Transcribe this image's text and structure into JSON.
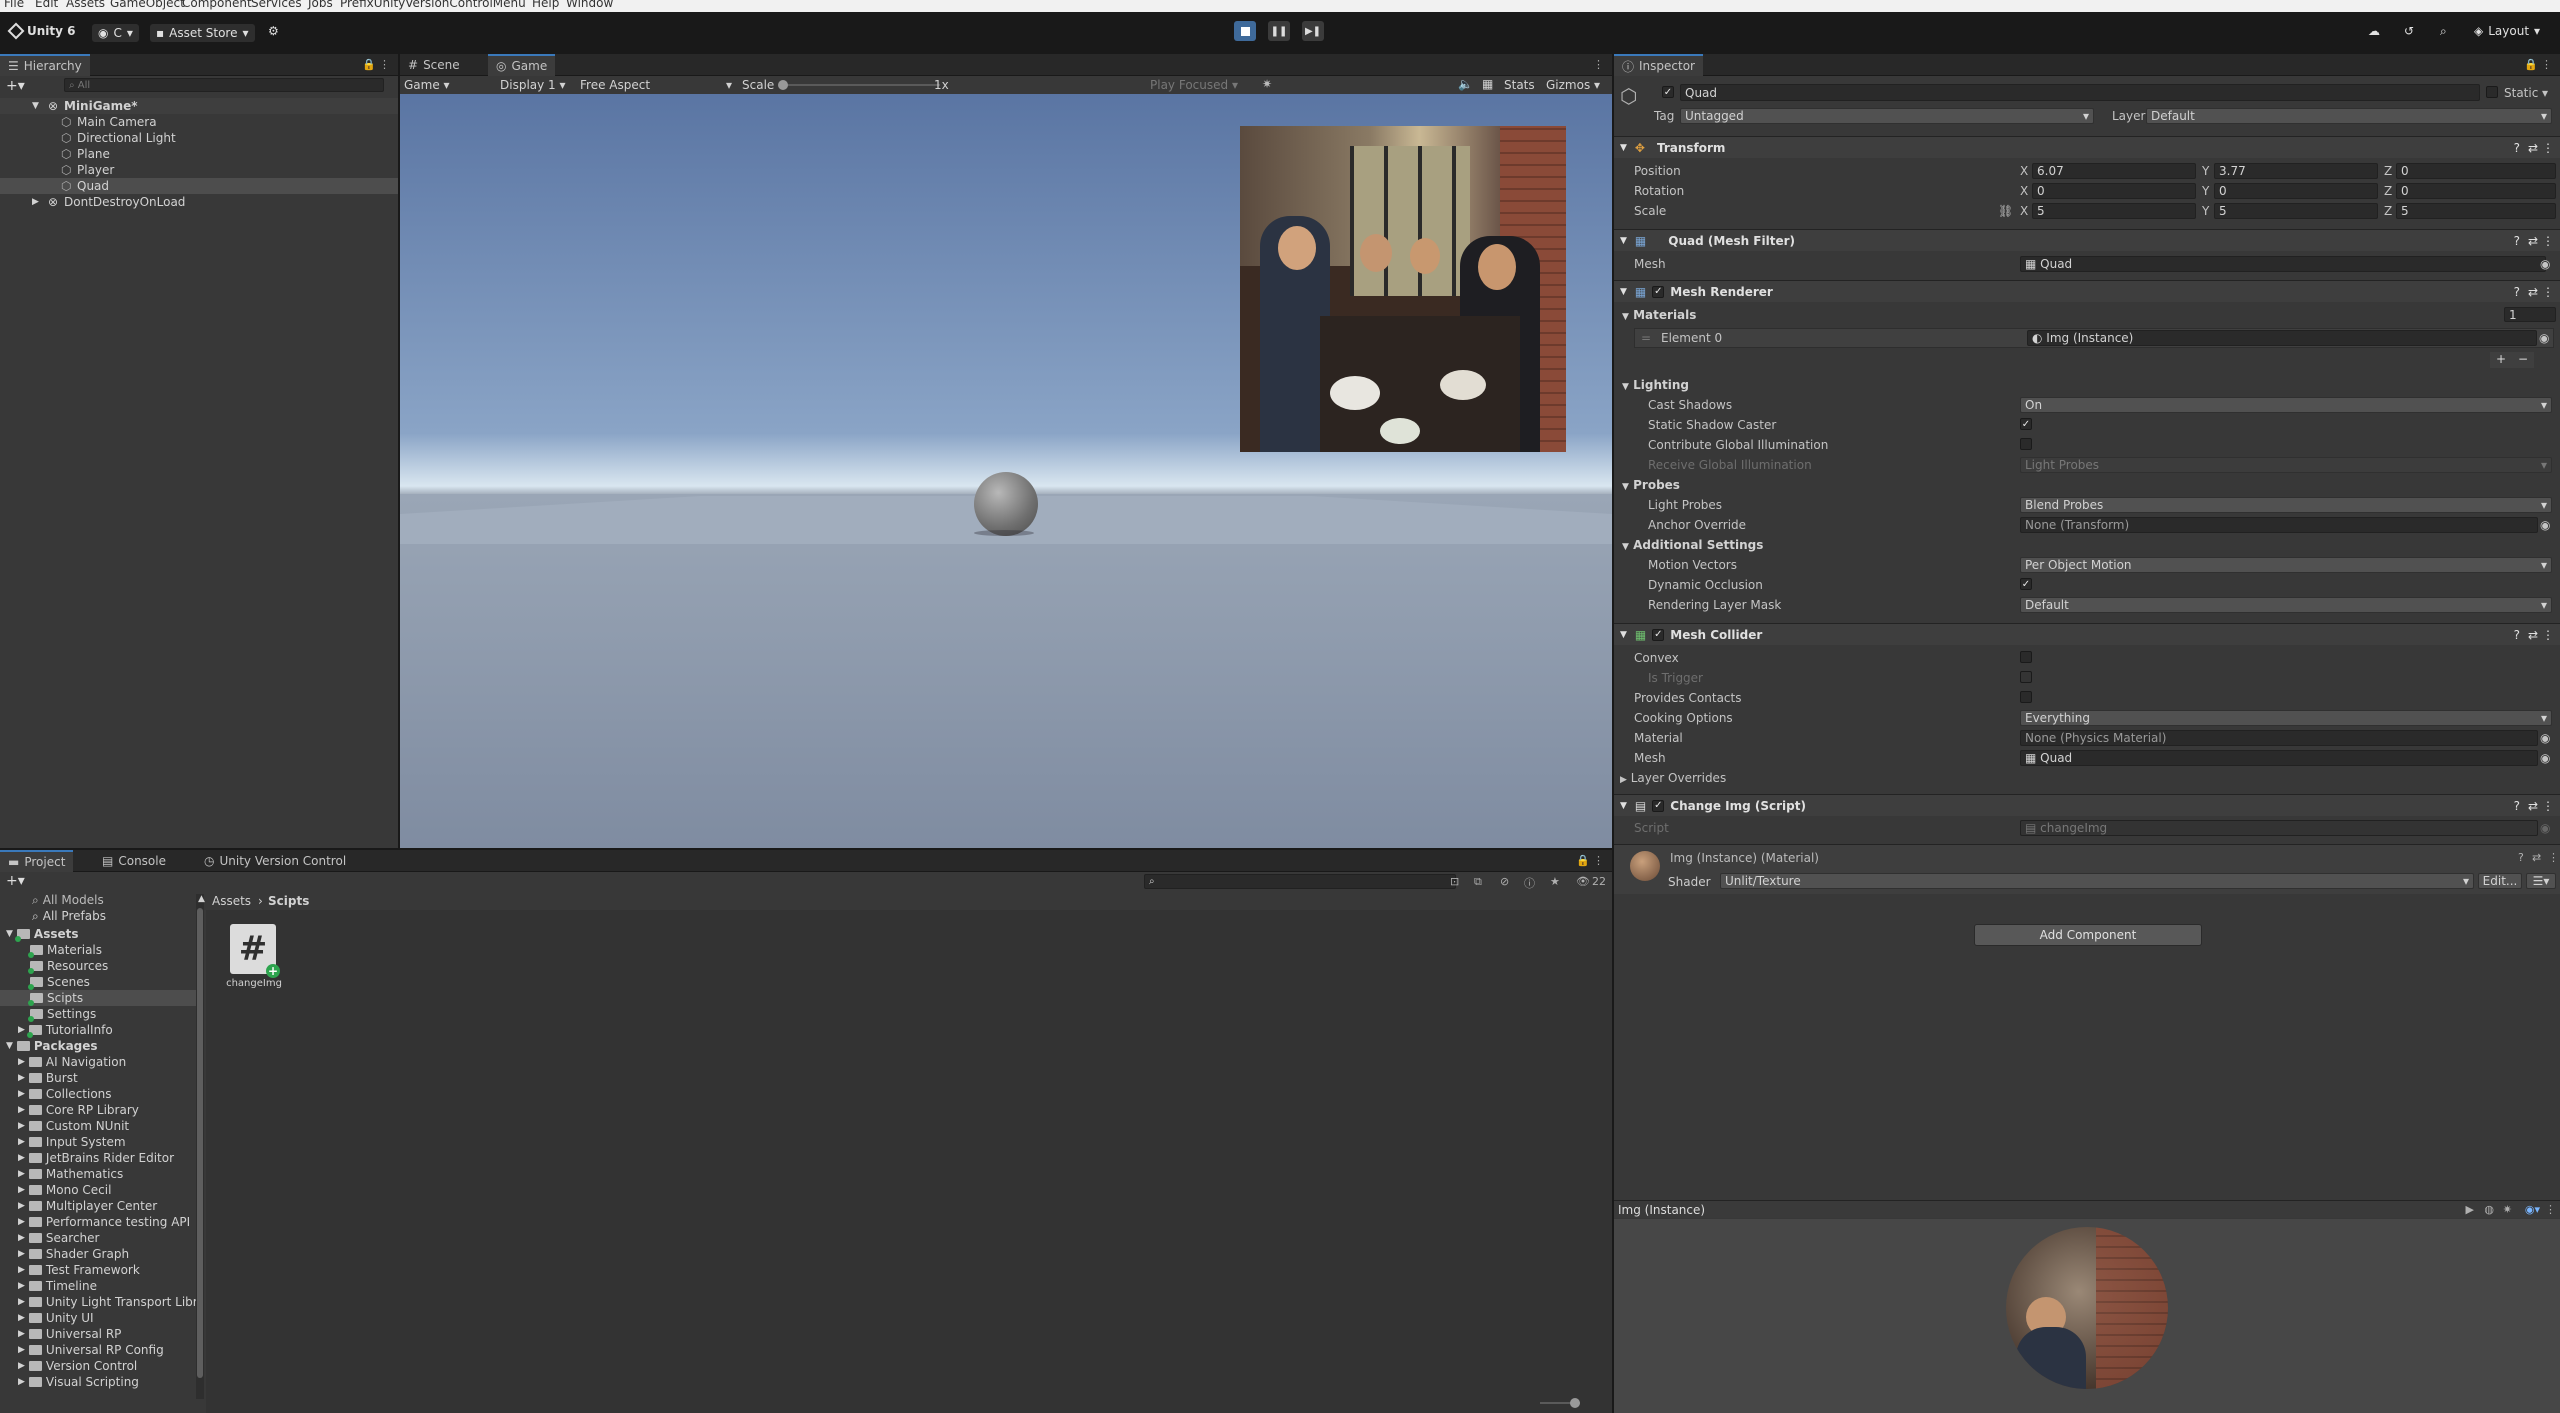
{
  "menu": [
    "File",
    "Edit",
    "Assets",
    "GameObject",
    "Component",
    "Services",
    "Jobs",
    "PrefixUnityVersionControlMenu",
    "Help",
    "Window"
  ],
  "toolbar": {
    "app_title": "Unity 6",
    "account_label": "C",
    "asset_store": "Asset Store",
    "layout": "Layout"
  },
  "hierarchy": {
    "tab": "Hierarchy",
    "search_placeholder": "All",
    "scene": "MiniGame*",
    "objects": [
      "Main Camera",
      "Directional Light",
      "Plane",
      "Player",
      "Quad"
    ],
    "dontdestroy": "DontDestroyOnLoad"
  },
  "scene_tabs": {
    "scene": "Scene",
    "game": "Game"
  },
  "game_bar": {
    "view": "Game",
    "display": "Display 1",
    "aspect": "Free Aspect",
    "scale_label": "Scale",
    "scale_value": "1x",
    "play_focused": "Play Focused",
    "stats": "Stats",
    "gizmos": "Gizmos"
  },
  "project": {
    "tabs": [
      "Project",
      "Console",
      "Unity Version Control"
    ],
    "favorites": [
      "All Models",
      "All Prefabs"
    ],
    "assets_root": "Assets",
    "assets": [
      "Materials",
      "Resources",
      "Scenes",
      "Scipts",
      "Settings",
      "TutorialInfo"
    ],
    "packages_root": "Packages",
    "packages": [
      "AI Navigation",
      "Burst",
      "Collections",
      "Core RP Library",
      "Custom NUnit",
      "Input System",
      "JetBrains Rider Editor",
      "Mathematics",
      "Mono Cecil",
      "Multiplayer Center",
      "Performance testing API",
      "Searcher",
      "Shader Graph",
      "Test Framework",
      "Timeline",
      "Unity Light Transport Libr",
      "Unity UI",
      "Universal RP",
      "Universal RP Config",
      "Version Control",
      "Visual Scripting"
    ],
    "breadcrumb": [
      "Assets",
      "Scipts"
    ],
    "file_name": "changeImg",
    "hidden_count": "22"
  },
  "inspector": {
    "tab": "Inspector",
    "object_name": "Quad",
    "static_label": "Static",
    "tag_label": "Tag",
    "tag_value": "Untagged",
    "layer_label": "Layer",
    "layer_value": "Default",
    "transform": {
      "title": "Transform",
      "position_label": "Position",
      "px": "6.07",
      "py": "3.77",
      "pz": "0",
      "rotation_label": "Rotation",
      "rx": "0",
      "ry": "0",
      "rz": "0",
      "scale_label": "Scale",
      "sx": "5",
      "sy": "5",
      "sz": "5",
      "x": "X",
      "y": "Y",
      "z": "Z"
    },
    "mesh_filter": {
      "title": "Quad (Mesh Filter)",
      "mesh_label": "Mesh",
      "mesh_value": "Quad"
    },
    "mesh_renderer": {
      "title": "Mesh Renderer",
      "materials": "Materials",
      "materials_count": "1",
      "element0": "Element 0",
      "element0_value": "Img (Instance)",
      "lighting": "Lighting",
      "cast_shadows": "Cast Shadows",
      "cast_shadows_value": "On",
      "static_shadow": "Static Shadow Caster",
      "contribute_gi": "Contribute Global Illumination",
      "receive_gi": "Receive Global Illumination",
      "receive_gi_value": "Light Probes",
      "probes": "Probes",
      "light_probes": "Light Probes",
      "light_probes_value": "Blend Probes",
      "anchor_override": "Anchor Override",
      "anchor_override_value": "None (Transform)",
      "additional": "Additional Settings",
      "motion_vectors": "Motion Vectors",
      "motion_vectors_value": "Per Object Motion",
      "dynamic_occlusion": "Dynamic Occlusion",
      "rendering_layer": "Rendering Layer Mask",
      "rendering_layer_value": "Default"
    },
    "mesh_collider": {
      "title": "Mesh Collider",
      "convex": "Convex",
      "is_trigger": "Is Trigger",
      "provides_contacts": "Provides Contacts",
      "cooking": "Cooking Options",
      "cooking_value": "Everything",
      "material": "Material",
      "material_value": "None (Physics Material)",
      "mesh": "Mesh",
      "mesh_value": "Quad",
      "layer_overrides": "Layer Overrides"
    },
    "script_comp": {
      "title": "Change Img (Script)",
      "script_label": "Script",
      "script_value": "changeImg"
    },
    "material": {
      "title": "Img (Instance) (Material)",
      "shader_label": "Shader",
      "shader_value": "Unlit/Texture",
      "edit": "Edit..."
    },
    "add_component": "Add Component",
    "preview_title": "Img (Instance)"
  },
  "colors": {
    "accent": "#3a79bb",
    "panel": "#383838",
    "header": "#282828",
    "selection": "#2c5d87"
  }
}
